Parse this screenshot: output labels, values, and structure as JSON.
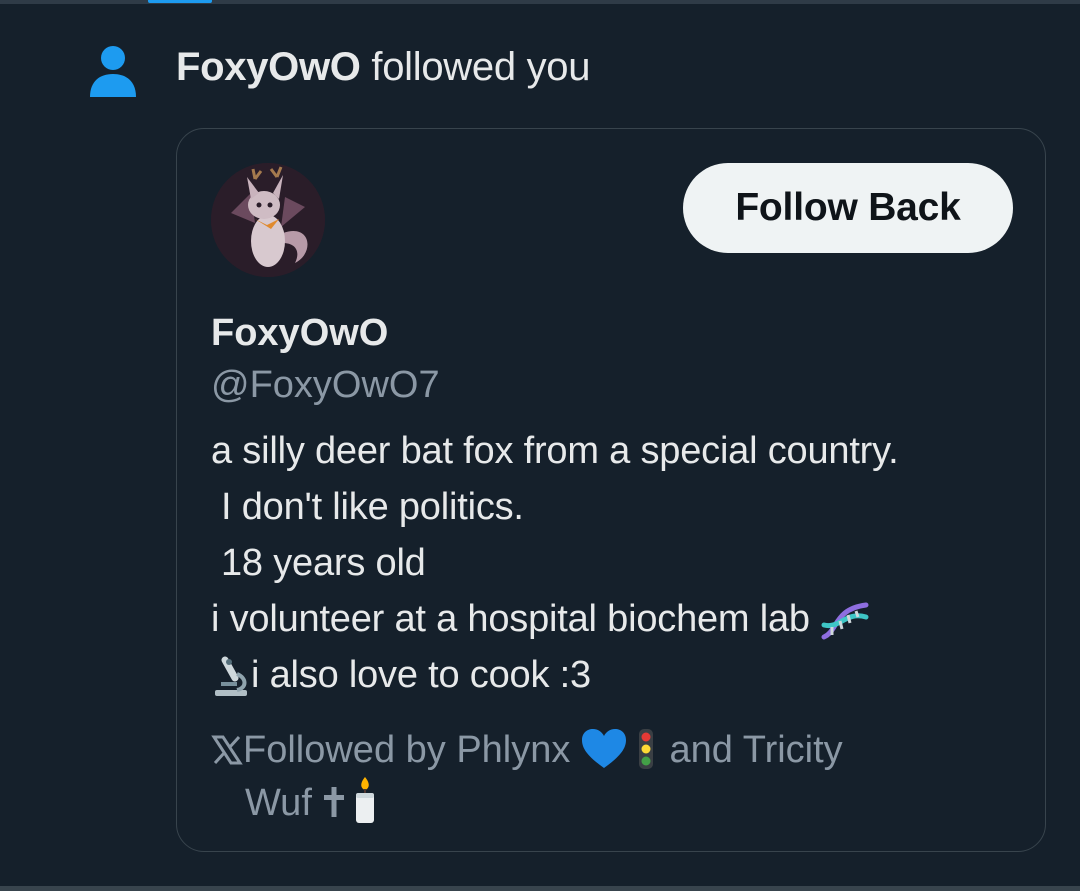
{
  "notification": {
    "actor_name": "FoxyOwO",
    "action_text": " followed you",
    "icon": "person-icon"
  },
  "card": {
    "follow_button_label": "Follow Back",
    "display_name": "FoxyOwO",
    "handle": "@FoxyOwO7",
    "bio": {
      "line1": "a silly deer bat fox from a special country.",
      "line2": "I don't like politics.",
      "line3": "18 years old",
      "line4": "i volunteer at a hospital biochem lab ",
      "line5": "i also love to cook :3",
      "emoji_dna": "dna-emoji",
      "emoji_microscope": "microscope-emoji"
    },
    "followed_by": {
      "prefix": "Followed by Phlynx ",
      "middle": " and Tricity",
      "line2": "Wuf ",
      "x_icon": "x-logo-icon",
      "emoji_heart": "blue-heart-emoji",
      "emoji_traffic_light": "traffic-light-emoji",
      "emoji_cross": "cross-emoji",
      "emoji_candle": "candle-emoji"
    }
  },
  "colors": {
    "background": "#15202b",
    "accent": "#1d9bf0",
    "text_primary": "#e7e9ea",
    "text_secondary": "#8b98a5",
    "border": "#38444d",
    "button_bg": "#eff3f4"
  }
}
